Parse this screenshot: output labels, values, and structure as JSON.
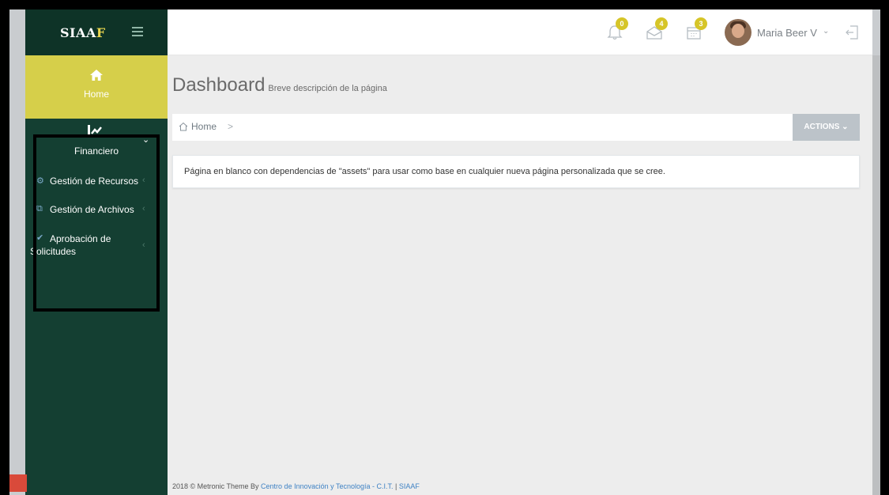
{
  "app": {
    "logo_main": "SIAA",
    "logo_accent": "F"
  },
  "sidebar": {
    "home_label": "Home",
    "section_label": "Financiero",
    "items": [
      {
        "label": "Gestión de Recursos",
        "icon": "cogs-icon"
      },
      {
        "label": "Gestión de Archivos",
        "icon": "files-icon"
      },
      {
        "label_line1": "Aprobación de",
        "label_line2": "Solicitudes",
        "icon": "check-icon"
      }
    ]
  },
  "header": {
    "notifications_count": "0",
    "messages_count": "4",
    "calendar_count": "3",
    "user_name": "Maria Beer V",
    "user_chevron": "⌄"
  },
  "page": {
    "title": "Dashboard",
    "subtitle": "Breve descripción de la página",
    "breadcrumb_home": "Home",
    "breadcrumb_sep": ">",
    "actions_label": "ACTIONS ⌄",
    "note": "Página en blanco con dependencias de \"assets\" para usar como base en cualquier nueva página personalizada que se cree."
  },
  "footer": {
    "prefix": "2018 © Metronic Theme By",
    "org_link": "Centro de Innovación y Tecnología - C.I.T.",
    "divider": "|",
    "app_link": "SIAAF"
  },
  "colors": {
    "sidebar": "#143f32",
    "active_item": "#d6cf4a",
    "badge": "#d6c528",
    "link": "#3f82c4"
  }
}
